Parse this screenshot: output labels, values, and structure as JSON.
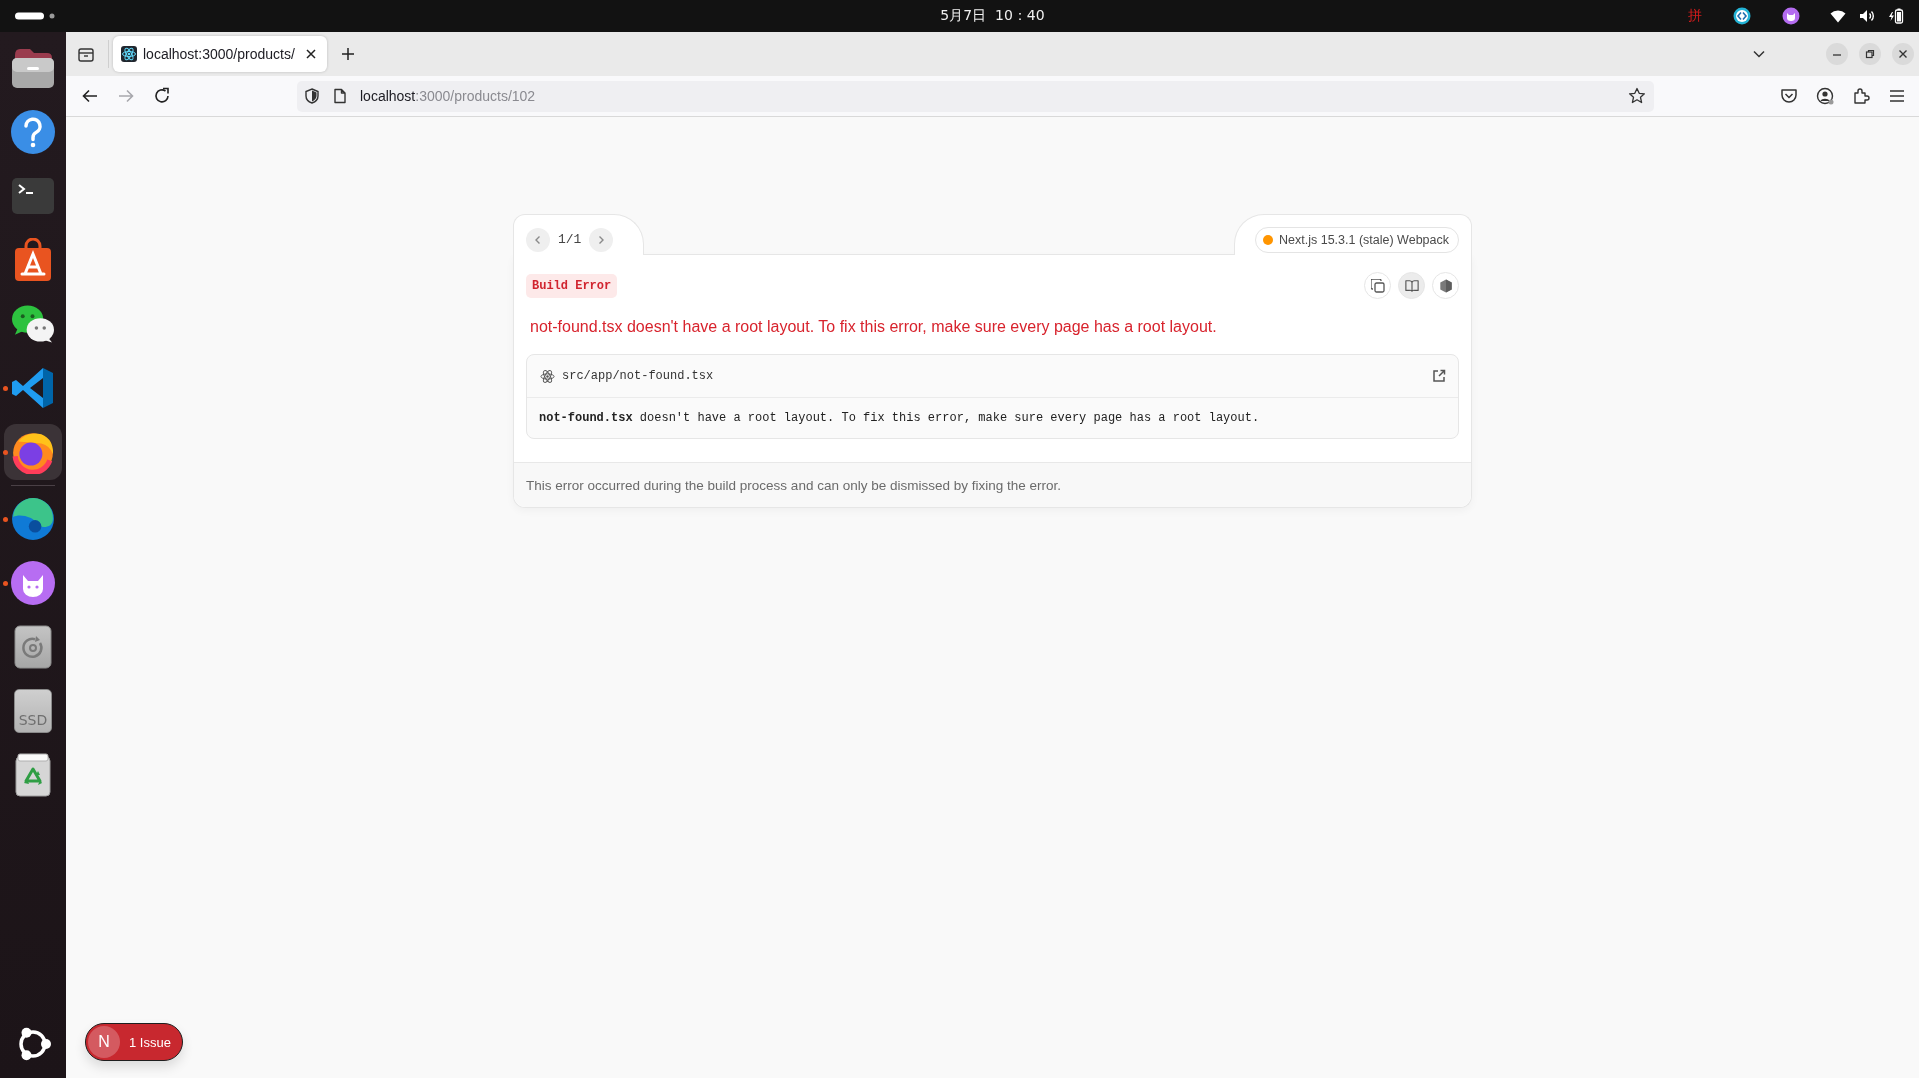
{
  "top_bar": {
    "clock": "5月7日  10：40",
    "input_method": "拼"
  },
  "dock": {
    "pinned": [
      {
        "kind": "files",
        "running": false,
        "focused": false
      },
      {
        "kind": "help",
        "running": false,
        "focused": false
      },
      {
        "kind": "terminal",
        "running": false,
        "focused": false
      },
      {
        "kind": "app_store",
        "running": false,
        "focused": false
      },
      {
        "kind": "chat",
        "running": false,
        "focused": false
      },
      {
        "kind": "code_editor",
        "running": true,
        "focused": false
      },
      {
        "kind": "firefox",
        "running": true,
        "focused": true
      }
    ],
    "others": [
      {
        "kind": "edge",
        "running": true,
        "focused": false
      },
      {
        "kind": "cat_app",
        "running": true,
        "focused": false
      },
      {
        "kind": "disc",
        "running": false,
        "focused": false
      },
      {
        "kind": "drive",
        "label": "SSD",
        "running": false,
        "focused": false
      },
      {
        "kind": "trash",
        "running": false,
        "focused": false
      }
    ]
  },
  "browser": {
    "tabs": [
      {
        "title": "localhost:3000/products/",
        "selected": true
      }
    ],
    "url": {
      "host": "localhost",
      "path": ":3000/products/102"
    }
  },
  "error_overlay": {
    "pagination": "1/1",
    "version_badge": "Next.js 15.3.1 (stale) Webpack",
    "error_type": "Build Error",
    "actions": [
      {
        "kind": "copy",
        "hovered": false
      },
      {
        "kind": "docs",
        "hovered": true
      },
      {
        "kind": "node",
        "hovered": false
      }
    ],
    "title": "not-found.tsx doesn't have a root layout. To fix this error, make sure every page has a root layout.",
    "code_frame": {
      "file": "src/app/not-found.tsx",
      "message": "**not-found.tsx** doesn't have a root layout. To fix this error, make sure every page has a root layout."
    },
    "footer": "This error occurred during the build process and can only be dismissed by fixing the error."
  },
  "issues_button": {
    "logo": "N",
    "label": "1 Issue"
  }
}
